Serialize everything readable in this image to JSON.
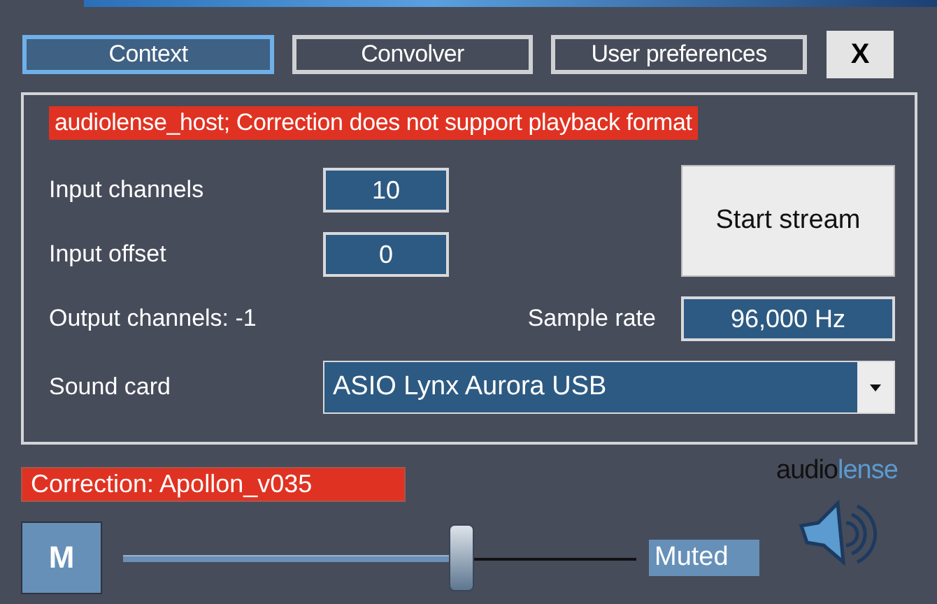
{
  "tabs": [
    {
      "label": "Context",
      "selected": true
    },
    {
      "label": "Convolver",
      "selected": false
    },
    {
      "label": "User preferences",
      "selected": false
    }
  ],
  "close_button": "X",
  "panel": {
    "error": "audiolense_host; Correction does not support playback format",
    "input_channels": {
      "label": "Input channels",
      "value": "10"
    },
    "input_offset": {
      "label": "Input offset",
      "value": "0"
    },
    "start_button": "Start stream",
    "output_channels": "Output channels: -1",
    "sample_rate": {
      "label": "Sample rate",
      "value": "96,000 Hz"
    },
    "sound_card": {
      "label": "Sound card",
      "value": "ASIO Lynx Aurora USB"
    }
  },
  "correction": "Correction: Apollon_v035",
  "mute_button": "M",
  "volume": {
    "level": 0.66,
    "reading": "Muted"
  },
  "logo": {
    "part_1": "audio",
    "part_2": "lense"
  }
}
